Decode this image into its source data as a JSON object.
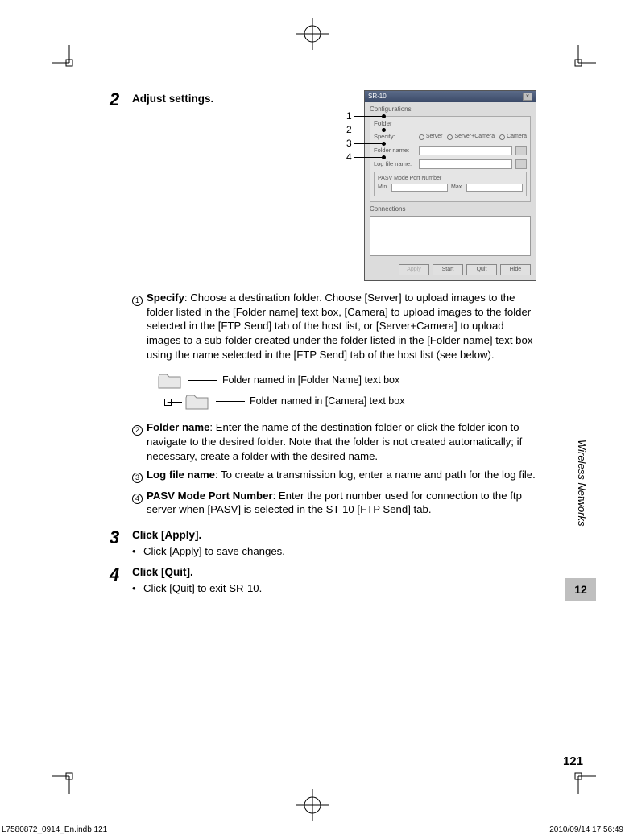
{
  "steps": {
    "s2": {
      "num": "2",
      "title": "Adjust settings."
    },
    "s3": {
      "num": "3",
      "title": "Click [Apply].",
      "bullet": "Click [Apply] to save changes."
    },
    "s4": {
      "num": "4",
      "title": "Click [Quit].",
      "bullet": "Click [Quit] to exit SR-10."
    }
  },
  "pointer_nums": {
    "p1": "1",
    "p2": "2",
    "p3": "3",
    "p4": "4"
  },
  "dialog": {
    "title": "SR-10",
    "config_label": "Configurations",
    "folder_label": "Folder",
    "row_specify": "Specify:",
    "radios": {
      "server": "Server",
      "sc": "Server+Camera",
      "camera": "Camera"
    },
    "row_foldername": "Folder name:",
    "row_logfile": "Log file name:",
    "pasv_label": "PASV Mode Port Number",
    "min": "Min.",
    "max": "Max.",
    "connections": "Connections",
    "btn_apply": "Apply",
    "btn_start": "Start",
    "btn_quit": "Quit",
    "btn_hide": "Hide"
  },
  "items": {
    "i1": {
      "n": "1",
      "bold": "Specify",
      "text": ": Choose a destination folder. Choose [Server] to upload images to the folder listed in the [Folder name] text box, [Camera] to upload images to the folder selected in the [FTP Send] tab of the host list, or [Server+Camera] to upload images to a sub-folder created under the folder listed in the [Folder name] text box using the name selected in the [FTP Send] tab of the host list (see below)."
    },
    "i2": {
      "n": "2",
      "bold": "Folder name",
      "text": ": Enter the name of the destination folder or click the folder icon to navigate to the desired folder. Note that the folder is not created automatically; if necessary, create a folder with the desired name."
    },
    "i3": {
      "n": "3",
      "bold": "Log file name",
      "text": ": To create a transmission log, enter a name and path for the log file."
    },
    "i4": {
      "n": "4",
      "bold": "PASV Mode Port Number",
      "text": ": Enter the port number used for connection to the ftp server when [PASV] is selected in the ST-10 [FTP Send] tab."
    }
  },
  "tree": {
    "line1": "Folder named in [Folder Name] text box",
    "line2": "Folder named in [Camera] text box"
  },
  "side": {
    "label": "Wireless Networks",
    "chapter": "12"
  },
  "page_num": "121",
  "footer": {
    "left": "L7580872_0914_En.indb   121",
    "right": "2010/09/14   17:56:49"
  }
}
